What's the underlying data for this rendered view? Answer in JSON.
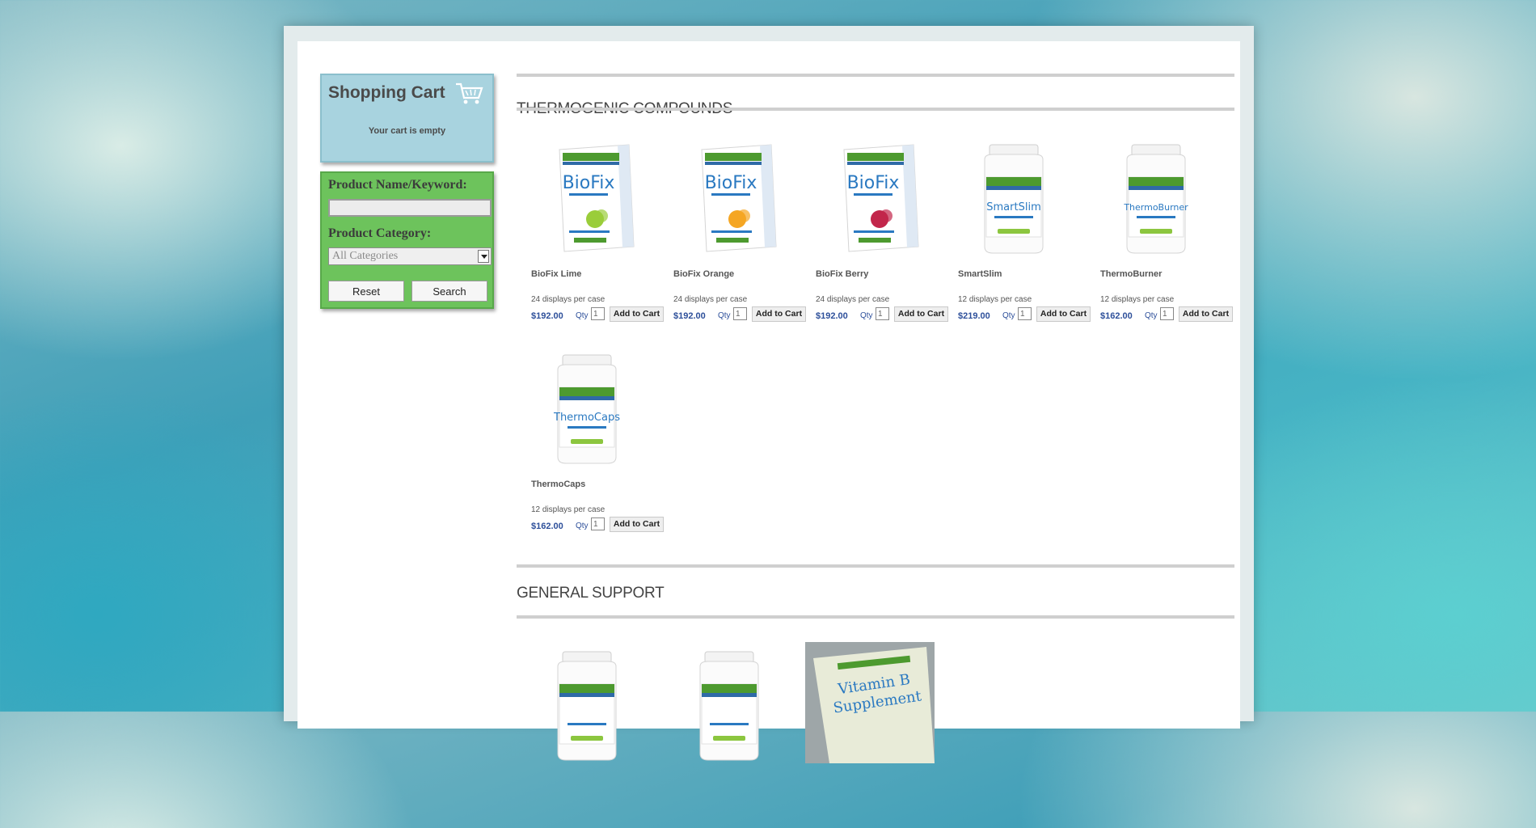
{
  "cart": {
    "title": "Shopping Cart",
    "status": "Your cart is empty"
  },
  "search": {
    "keyword_label": "Product Name/Keyword:",
    "keyword_value": "",
    "category_label": "Product Category:",
    "category_selected": "All Categories",
    "reset_label": "Reset",
    "search_label": "Search"
  },
  "sections": [
    {
      "title": "THERMOGENIC COMPOUNDS",
      "products": [
        {
          "name": "BioFix Lime",
          "case": "24 displays per case",
          "price": "$192.00",
          "qty_label": "Qty",
          "qty": "1",
          "add_label": "Add to Cart",
          "kind": "box",
          "accent": "#9acd3a"
        },
        {
          "name": "BioFix Orange",
          "case": "24 displays per case",
          "price": "$192.00",
          "qty_label": "Qty",
          "qty": "1",
          "add_label": "Add to Cart",
          "kind": "box",
          "accent": "#f5a623"
        },
        {
          "name": "BioFix Berry",
          "case": "24 displays per case",
          "price": "$192.00",
          "qty_label": "Qty",
          "qty": "1",
          "add_label": "Add to Cart",
          "kind": "box",
          "accent": "#c2264b"
        },
        {
          "name": "SmartSlim",
          "case": "12 displays per case",
          "price": "$219.00",
          "qty_label": "Qty",
          "qty": "1",
          "add_label": "Add to Cart",
          "kind": "bottle",
          "label_text": "SmartSlim"
        },
        {
          "name": "ThermoBurner",
          "case": "12 displays per case",
          "price": "$162.00",
          "qty_label": "Qty",
          "qty": "1",
          "add_label": "Add to Cart",
          "kind": "bottle",
          "label_text": "ThermoBurner"
        },
        {
          "name": "ThermoCaps",
          "case": "12 displays per case",
          "price": "$162.00",
          "qty_label": "Qty",
          "qty": "1",
          "add_label": "Add to Cart",
          "kind": "bottle",
          "label_text": "ThermoCaps"
        }
      ]
    },
    {
      "title": "GENERAL SUPPORT",
      "products": [
        {
          "kind": "bottle"
        },
        {
          "kind": "bottle"
        },
        {
          "kind": "photo"
        }
      ]
    }
  ],
  "colors": {
    "cart_bg": "#a8d3df",
    "search_bg": "#6dc35c",
    "price": "#2d4f9a"
  }
}
